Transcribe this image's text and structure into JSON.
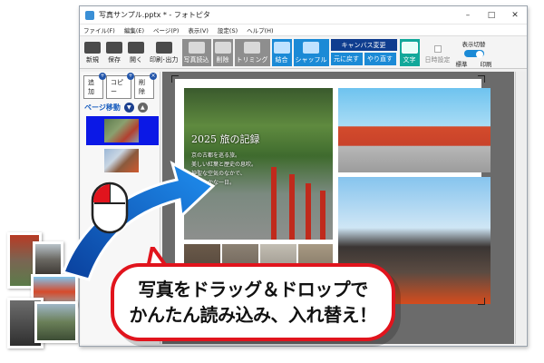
{
  "window": {
    "title": "写真サンプル.pptx * - フォトピタ",
    "controls": [
      "–",
      "□",
      "✕"
    ]
  },
  "menu": [
    "ファイル(F)",
    "編集(E)",
    "ページ(P)",
    "表示(V)",
    "設定(S)",
    "ヘルプ(H)"
  ],
  "toolbar": {
    "new": "新規",
    "save": "保存",
    "open": "開く",
    "print": "印刷･出力",
    "photo_load": "写真読込",
    "delete": "削除",
    "trim": "トリミング",
    "combine": "結合",
    "shuffle": "シャッフル",
    "canvas_change": "キャンバス変更",
    "undo": "元に戻す",
    "redo": "やり直す",
    "text": "文字",
    "datetime": "日時設定",
    "view_switch": "表示切替",
    "view_standard": "標準",
    "view_print": "印刷"
  },
  "sidebar": {
    "add": "追加",
    "copy": "コピー",
    "delete": "削除",
    "page_move": "ページ移動"
  },
  "canvas": {
    "caption_title": "2025 旅の記録",
    "caption_lines": [
      "京の古都を巡る旅。",
      "美しい紅葉と歴史の息吹。",
      "神聖な空気のなかで、",
      "心穏やかな一日。"
    ]
  },
  "callout": {
    "line1": "写真をドラッグ＆ドロップで",
    "line2": "かんたん読み込み、入れ替え！"
  },
  "colors": {
    "accent_blue": "#1b8ad6",
    "dark_blue": "#0f3d8f",
    "selection_blue": "#0b18e6",
    "callout_red": "#e1141d",
    "teal": "#12a89a"
  },
  "icons": {
    "arrow": "drag-arrow-icon",
    "mouse": "mouse-icon"
  }
}
